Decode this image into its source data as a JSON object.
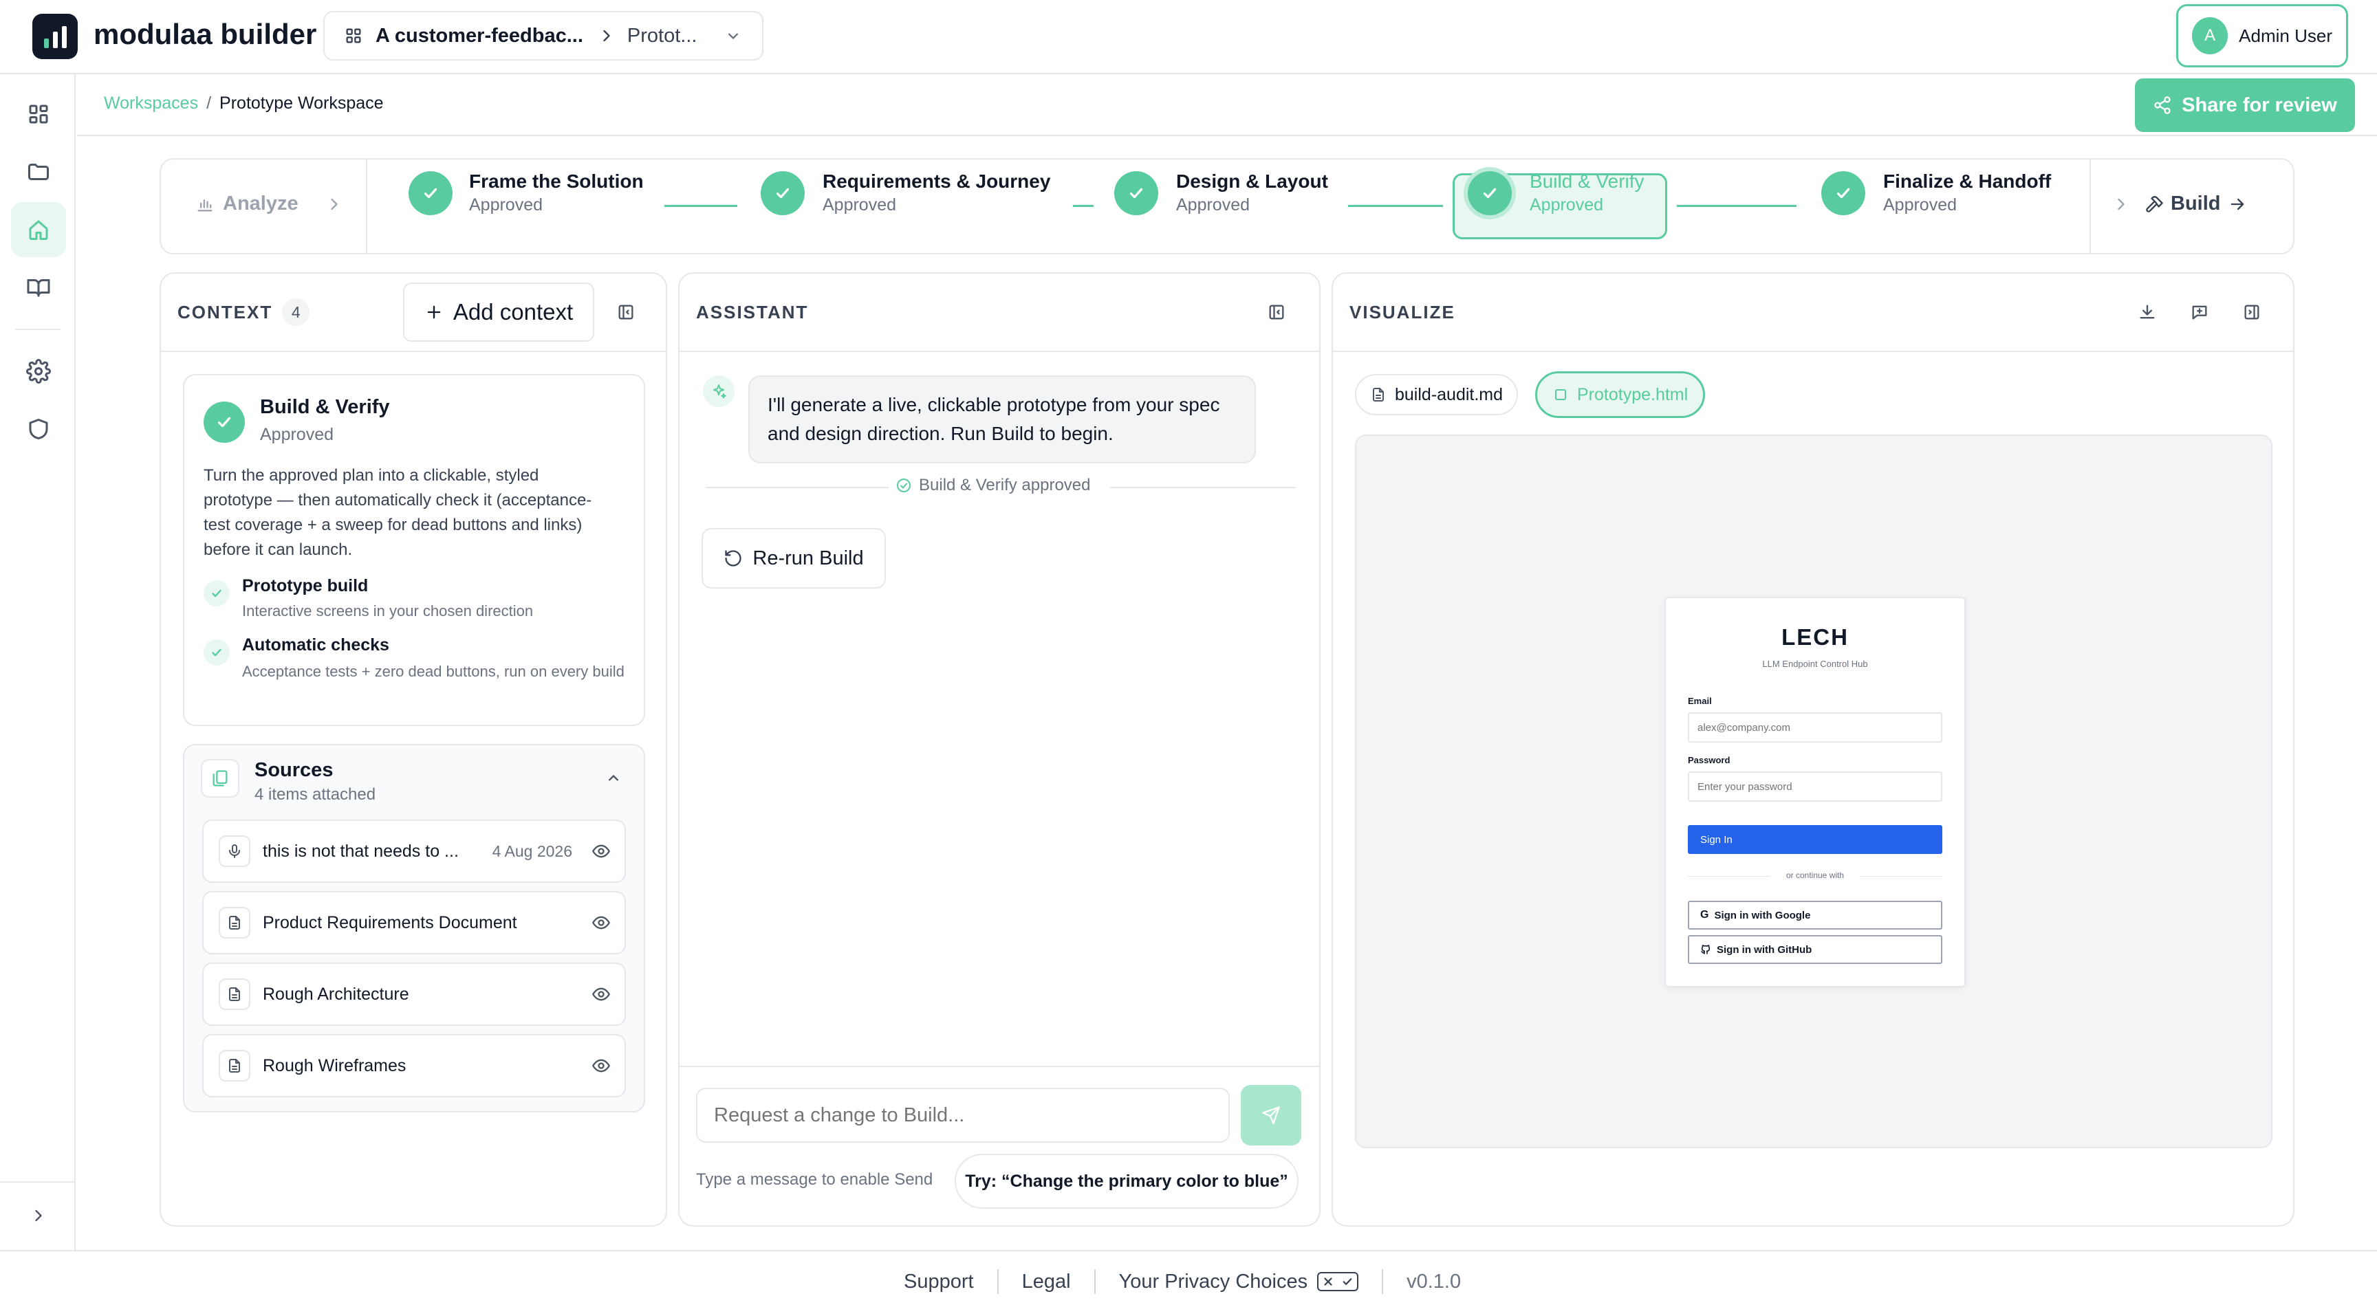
{
  "app": {
    "name": "modulaa builder"
  },
  "project_switcher": {
    "project": "A customer-feedbac...",
    "workspace": "Protot..."
  },
  "user": {
    "initial": "A",
    "name": "Admin User"
  },
  "breadcrumb": {
    "root": "Workspaces",
    "separator": "/",
    "current": "Prototype Workspace"
  },
  "share_button": {
    "label": "Share for review"
  },
  "stepper": {
    "analyze_label": "Analyze",
    "build_label": "Build",
    "steps": [
      {
        "title": "Frame the Solution",
        "status": "Approved"
      },
      {
        "title": "Requirements & Journey",
        "status": "Approved"
      },
      {
        "title": "Design & Layout",
        "status": "Approved"
      },
      {
        "title": "Build & Verify",
        "status": "Approved"
      },
      {
        "title": "Finalize & Handoff",
        "status": "Approved"
      }
    ]
  },
  "context": {
    "heading": "CONTEXT",
    "count": "4",
    "add_label": "Add context",
    "phase_card": {
      "title": "Build & Verify",
      "status": "Approved",
      "description": "Turn the approved plan into a clickable, styled prototype — then automatically check it (acceptance-test coverage + a sweep for dead buttons and links) before it can launch.",
      "items": [
        {
          "title": "Prototype build",
          "desc": "Interactive screens in your chosen direction"
        },
        {
          "title": "Automatic checks",
          "desc": "Acceptance tests + zero dead buttons, run on every build"
        }
      ]
    },
    "sources": {
      "title": "Sources",
      "subtitle": "4 items attached",
      "items": [
        {
          "name": "this is not that needs to ...",
          "date": "4 Aug 2026",
          "icon": "microphone-icon"
        },
        {
          "name": "Product Requirements Document",
          "date": "",
          "icon": "document-icon"
        },
        {
          "name": "Rough Architecture",
          "date": "",
          "icon": "document-icon"
        },
        {
          "name": "Rough Wireframes",
          "date": "",
          "icon": "document-icon"
        }
      ]
    }
  },
  "assistant": {
    "heading": "ASSISTANT",
    "message": "I'll generate a live, clickable prototype from your spec and design direction. Run Build to begin.",
    "approved_note": "Build & Verify approved",
    "rerun_label": "Re-run Build",
    "input_placeholder": "Request a change to Build...",
    "hint": "Type a message to enable Send",
    "suggestion": "Try: “Change the primary color to blue”"
  },
  "visualize": {
    "heading": "VISUALIZE",
    "tabs": [
      {
        "label": "build-audit.md",
        "active": false
      },
      {
        "label": "Prototype.html",
        "active": true
      }
    ],
    "preview": {
      "title": "LECH",
      "subtitle": "LLM Endpoint Control Hub",
      "email_label": "Email",
      "email_placeholder": "alex@company.com",
      "password_label": "Password",
      "password_placeholder": "Enter your password",
      "signin_label": "Sign In",
      "divider": "or continue with",
      "google_label": "Sign in with Google",
      "github_label": "Sign in with GitHub"
    }
  },
  "footer": {
    "support": "Support",
    "legal": "Legal",
    "privacy": "Your Privacy Choices",
    "version": "v0.1.0"
  },
  "colors": {
    "accent": "#58cba0",
    "accent_light": "#e8f8f1",
    "signin_blue": "#2563eb"
  }
}
